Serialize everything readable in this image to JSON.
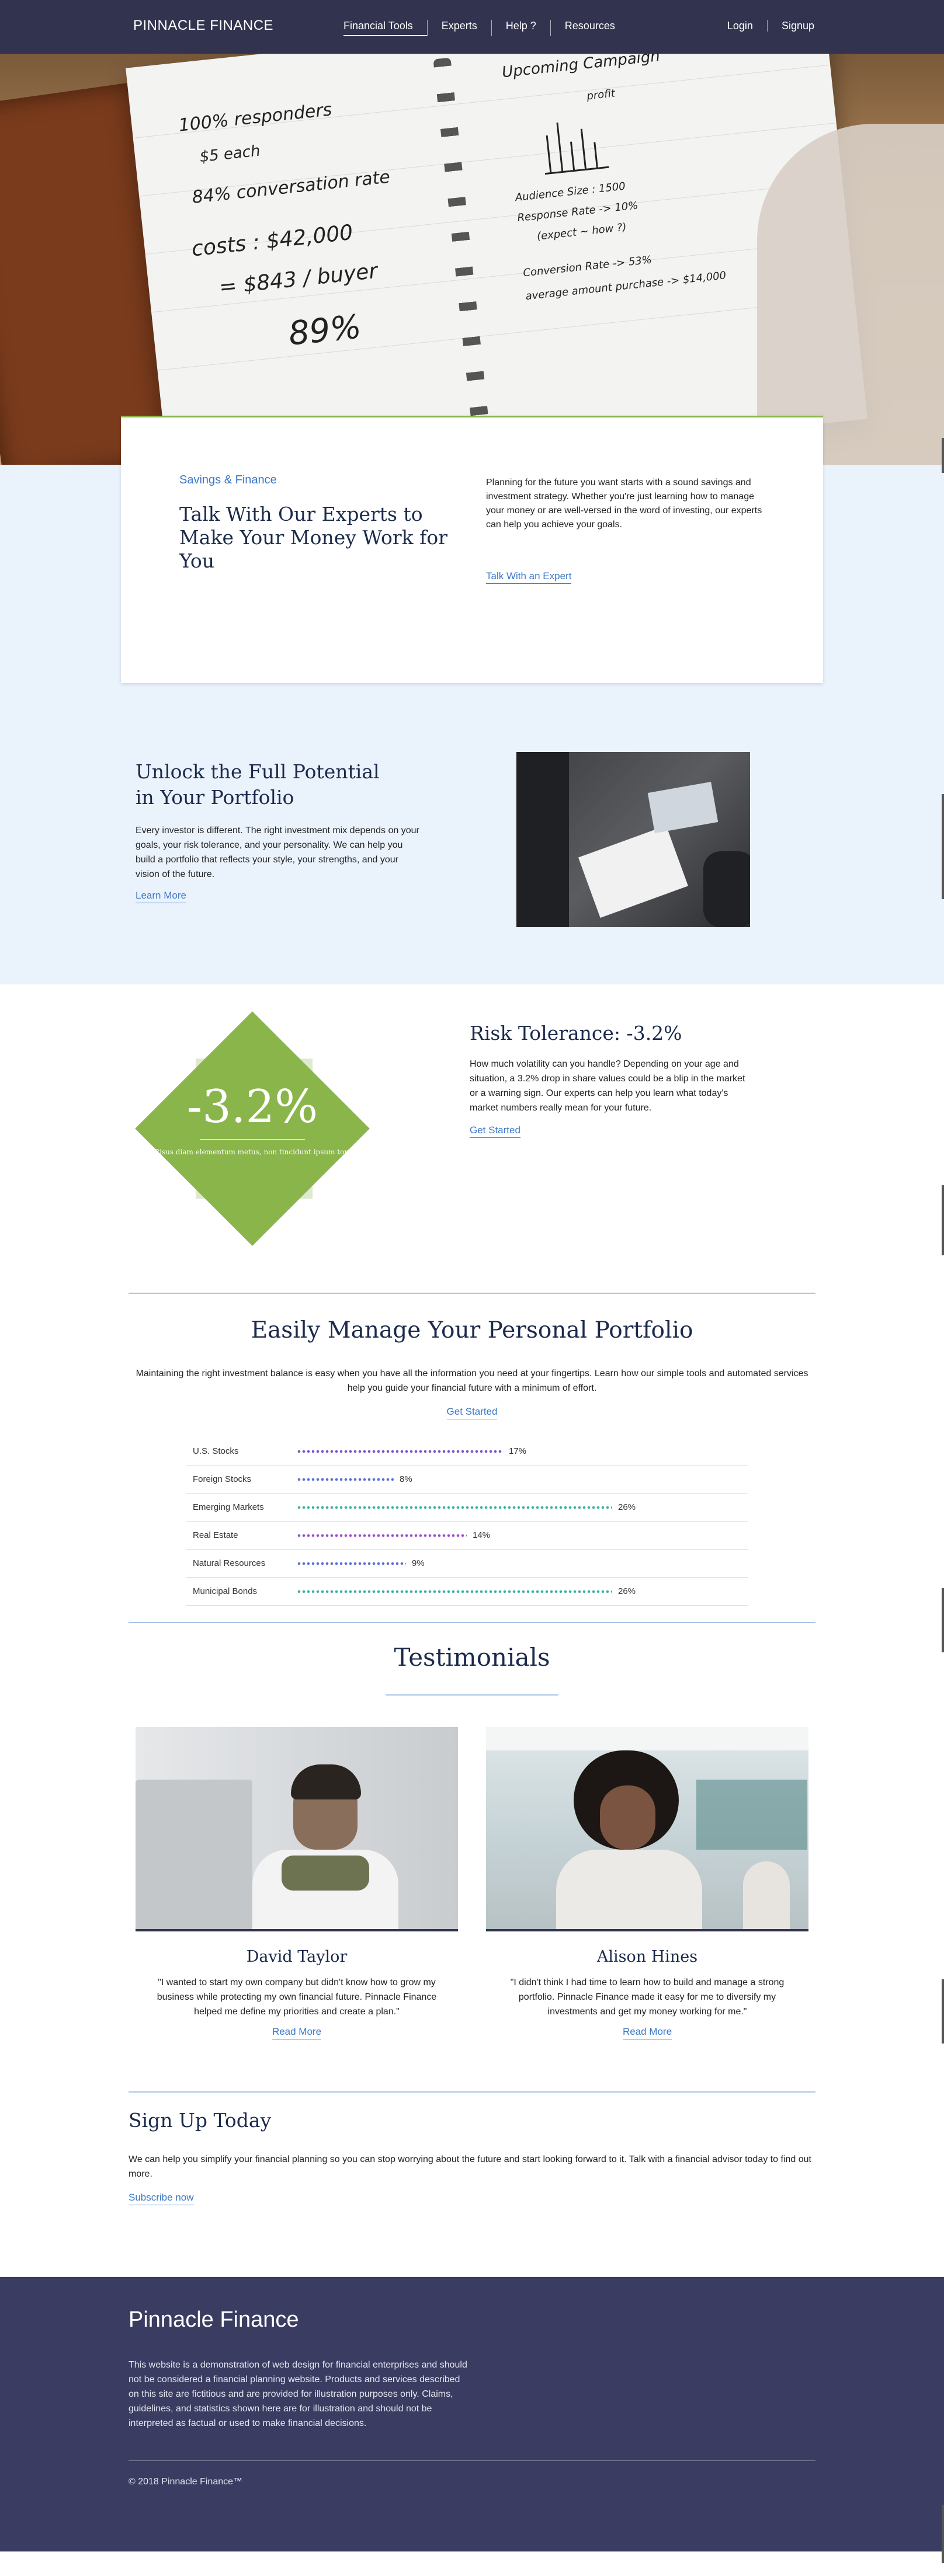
{
  "nav": {
    "brand": "PINNACLE FINANCE",
    "menu": [
      "Financial Tools",
      "Experts",
      "Help ?",
      "Resources"
    ],
    "auth": [
      "Login",
      "Signup"
    ]
  },
  "hero": {
    "notes_left": [
      "100% responders",
      "$5 each",
      "84% conversation rate",
      "costs : $42,000",
      "= $843 / buyer",
      "89%"
    ],
    "notes_right": [
      "Upcoming Campaign",
      "profit",
      "Audience Size : 1500",
      "Response Rate -> 10%",
      "(expect ~ how ?)",
      "Conversion Rate -> 53%",
      "average amount purchase -> $14,000"
    ]
  },
  "expert": {
    "eyebrow": "Savings & Finance",
    "title": "Talk With Our Experts to Make Your Money Work for You",
    "body": "Planning for the future you want starts with a sound savings and investment strategy. Whether you're just learning how to manage your money or are well-versed in the word of investing, our experts can help you achieve your goals.",
    "link": "Talk With an Expert"
  },
  "unlock": {
    "title": "Unlock the Full Potential in Your Portfolio",
    "body": "Every investor is different. The right investment mix depends on your goals, your risk tolerance, and your personality. We can help you build a portfolio that reflects your style, your strengths, and your vision of the future.",
    "link": "Learn More"
  },
  "risk": {
    "value": "-3.2%",
    "caption": "Risus diam elementum metus, non tincidunt ipsum tort",
    "title": "Risk Tolerance: -3.2%",
    "body": "How much volatility can you handle? Depending on your age and situation, a 3.2% drop in share values could be a blip in the market or a warning sign. Our experts can help you learn what today's market numbers really mean for your future.",
    "link": "Get Started"
  },
  "portfolio": {
    "title": "Easily Manage Your Personal Portfolio",
    "body": "Maintaining the right investment balance is easy when you have all the information you need at your fingertips. Learn how our simple tools and automated services help you guide your financial future with a minimum of effort.",
    "link": "Get Started",
    "rows": [
      {
        "label": "U.S. Stocks",
        "value": 17,
        "pct": "17%",
        "color": "#7b52c9"
      },
      {
        "label": "Foreign Stocks",
        "value": 8,
        "pct": "8%",
        "color": "#5a6fd6"
      },
      {
        "label": "Emerging Markets",
        "value": 26,
        "pct": "26%",
        "color": "#3bb3a0"
      },
      {
        "label": "Real Estate",
        "value": 14,
        "pct": "14%",
        "color": "#9a4fd0"
      },
      {
        "label": "Natural Resources",
        "value": 9,
        "pct": "9%",
        "color": "#5a6fd6"
      },
      {
        "label": "Municipal Bonds",
        "value": 26,
        "pct": "26%",
        "color": "#3bb3a0"
      }
    ]
  },
  "testimonials": {
    "title": "Testimonials",
    "items": [
      {
        "name": "David Taylor",
        "quote": "\"I wanted to start my own company but didn't know how to grow my business while protecting my own financial future. Pinnacle Finance helped me define my priorities and create a plan.\"",
        "link": "Read More"
      },
      {
        "name": "Alison Hines",
        "quote": "\"I didn't think I had time to learn how to build and manage a strong portfolio. Pinnacle Finance made it easy for me to diversify my investments and get my money working for me.\"",
        "link": "Read More"
      }
    ]
  },
  "signup": {
    "title": "Sign Up Today",
    "body": "We can help you simplify your financial planning so you can stop worrying about the future and start looking forward to it. Talk with a financial advisor today to find out more.",
    "link": "Subscribe now"
  },
  "footer": {
    "brand": "Pinnacle Finance",
    "body": "This website is a demonstration of web design for financial enterprises and should not be considered a financial planning website. Products and services described on this site are fictitious and are provided for illustration purposes only. Claims, guidelines, and statistics shown here are for illustration and should not be interpreted as factual or used to make financial decisions.",
    "copyright": "© 2018 Pinnacle Finance™"
  }
}
